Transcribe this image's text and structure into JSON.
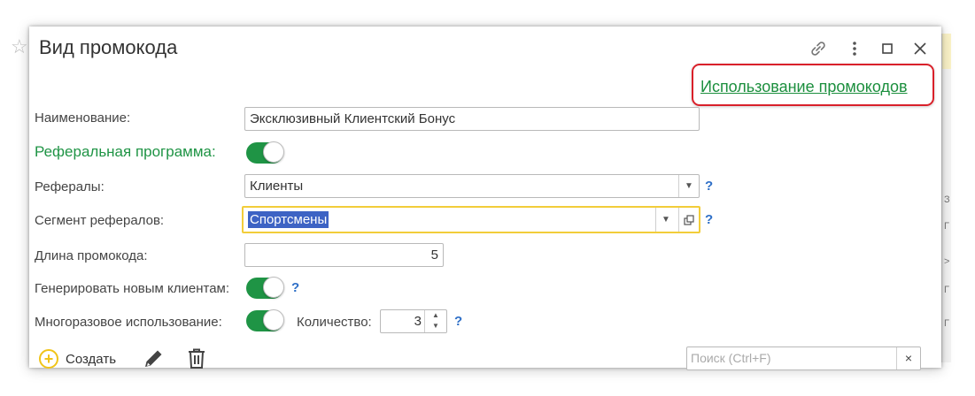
{
  "window": {
    "title": "Вид промокода",
    "star_icon": "☆"
  },
  "toolbar": {
    "link_icon": "link-icon",
    "more_icon": "more-vertical-icon",
    "maximize_icon": "maximize-icon",
    "close_icon": "close-icon"
  },
  "header_link": {
    "label": "Использование промокодов",
    "color": "#1c8f3e",
    "highlight_color": "#d9202a"
  },
  "form": {
    "name": {
      "label": "Наименование:",
      "value": "Эксклюзивный Клиентский Бонус"
    },
    "referral_program": {
      "label": "Реферальная программа:",
      "enabled": true
    },
    "referrals": {
      "label": "Рефералы:",
      "value": "Клиенты",
      "help": "?"
    },
    "referral_segment": {
      "label": "Сегмент рефералов:",
      "value": "Спортсмены",
      "help": "?"
    },
    "code_length": {
      "label": "Длина промокода:",
      "value": "5"
    },
    "generate_new_clients": {
      "label": "Генерировать новым клиентам:",
      "enabled": true,
      "help": "?"
    },
    "reusable": {
      "label": "Многоразовое использование:",
      "enabled": true
    },
    "quantity": {
      "label": "Количество:",
      "value": "3",
      "help": "?"
    }
  },
  "bottom_toolbar": {
    "create_label": "Создать",
    "search_placeholder": "Поиск (Ctrl+F)",
    "search_clear": "×"
  },
  "colors": {
    "accent_green": "#1f9445",
    "focus_yellow": "#f2cd3a",
    "selection_blue": "#3d63c4",
    "help_blue": "#2e6fc7"
  }
}
